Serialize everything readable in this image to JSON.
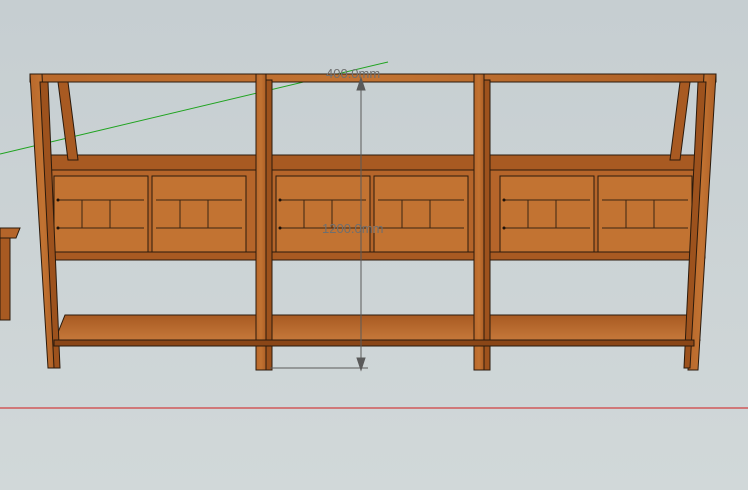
{
  "viewport": {
    "background": "#c9d1d3",
    "wood_color": "#b5652a",
    "wood_dark": "#8a4617",
    "outline_color": "#2b1a0c",
    "axis_green": "#1fa31f",
    "axis_red": "#d11a1a",
    "dimension_color": "#5a5a5a"
  },
  "dimensions": {
    "depth_label": "400.0mm",
    "height_label": "1200.0mm"
  },
  "model": {
    "name_icon": "bookshelf-cabinet-icon",
    "bays": 3,
    "doors_per_bay": 2
  }
}
